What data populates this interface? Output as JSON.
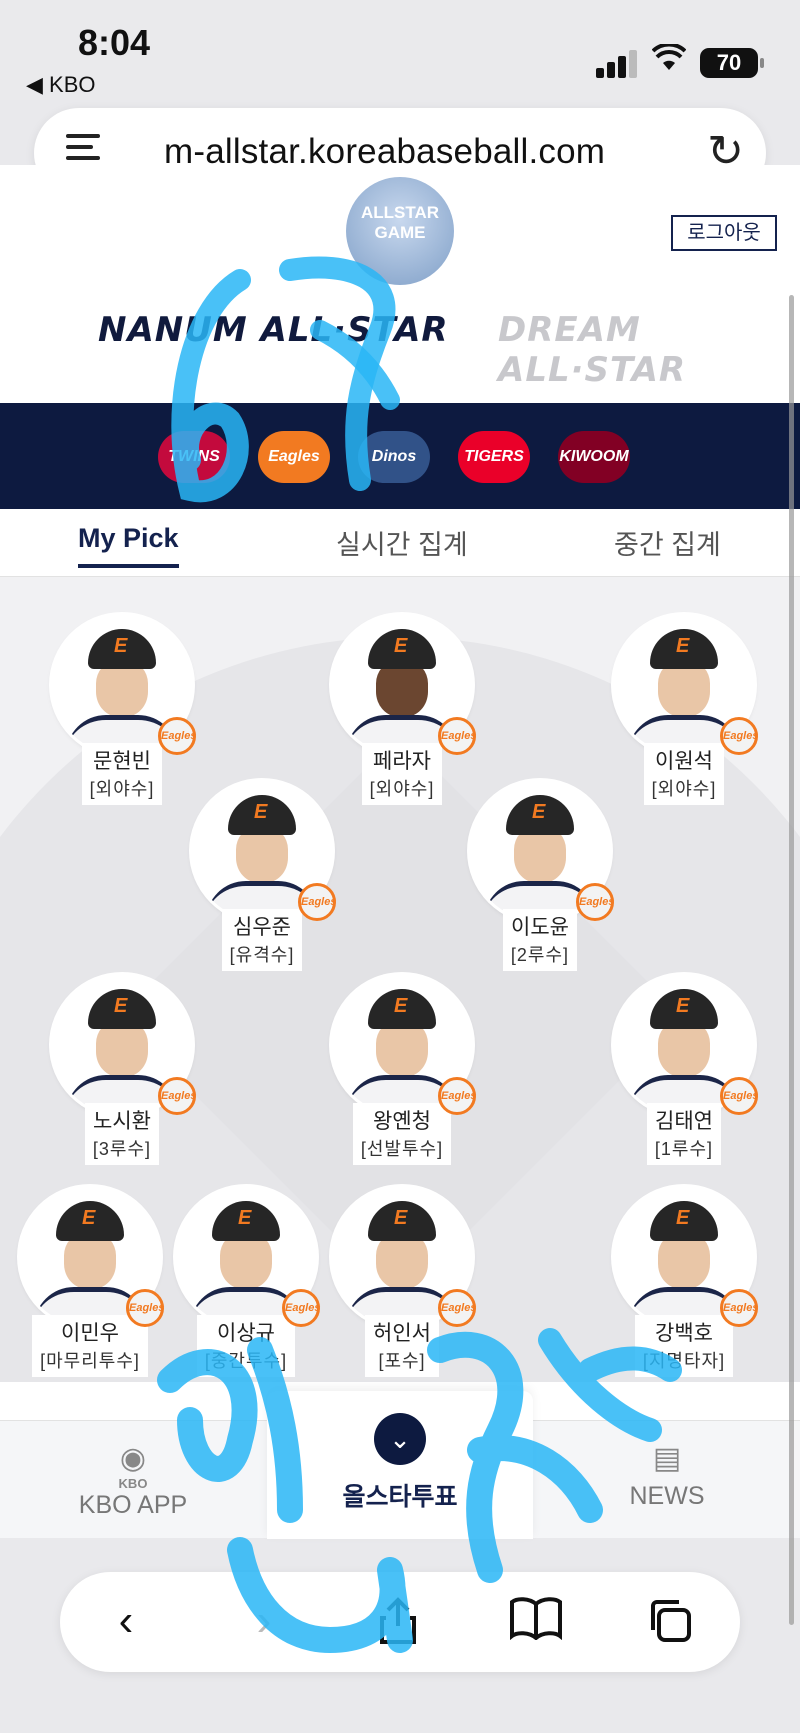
{
  "status": {
    "time": "8:04",
    "back_app": "◀ KBO",
    "battery": "70"
  },
  "browser": {
    "url": "m-allstar.koreabaseball.com"
  },
  "header": {
    "badge_lines": [
      "ALLSTAR",
      "GAME"
    ],
    "logout_label": "로그아웃",
    "team_left": "NANUM ALL·STAR",
    "team_right": "DREAM ALL·STAR"
  },
  "clubs": [
    {
      "name": "TWINS",
      "color": "#c30a3d"
    },
    {
      "name": "Eagles",
      "color": "#f27a21"
    },
    {
      "name": "Dinos",
      "color": "#315288"
    },
    {
      "name": "TIGERS",
      "color": "#ea0029"
    },
    {
      "name": "KIWOOM",
      "color": "#820024"
    }
  ],
  "tabs": [
    "My Pick",
    "실시간 집계",
    "중간 집계"
  ],
  "team_badge": "Eagles",
  "players": [
    {
      "name": "문현빈",
      "pos": "[외야수]",
      "dark": false
    },
    {
      "name": "페라자",
      "pos": "[외야수]",
      "dark": true
    },
    {
      "name": "이원석",
      "pos": "[외야수]",
      "dark": false
    },
    {
      "name": "심우준",
      "pos": "[유격수]",
      "dark": false
    },
    {
      "name": "이도윤",
      "pos": "[2루수]",
      "dark": false
    },
    {
      "name": "노시환",
      "pos": "[3루수]",
      "dark": false
    },
    {
      "name": "왕옌청",
      "pos": "[선발투수]",
      "dark": false
    },
    {
      "name": "김태연",
      "pos": "[1루수]",
      "dark": false
    },
    {
      "name": "이민우",
      "pos": "[마무리투수]",
      "dark": false
    },
    {
      "name": "이상규",
      "pos": "[중간투수]",
      "dark": false
    },
    {
      "name": "허인서",
      "pos": "[포수]",
      "dark": false
    },
    {
      "name": "강백호",
      "pos": "[지명타자]",
      "dark": false
    }
  ],
  "bottom_nav": {
    "left": "KBO APP",
    "left_small": "KBO",
    "center": "올스타투표",
    "right": "NEWS"
  }
}
